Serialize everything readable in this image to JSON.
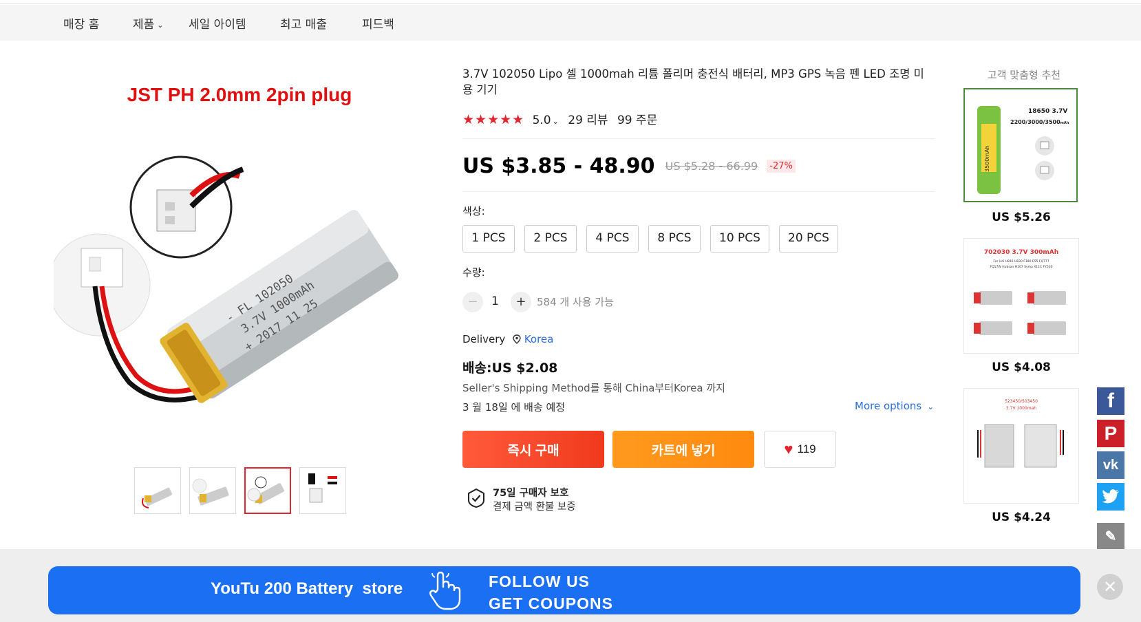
{
  "nav": {
    "items": [
      "매장 홈",
      "제품",
      "세일 아이템",
      "최고 매출",
      "피드백"
    ]
  },
  "gallery": {
    "image_caption": "JST PH 2.0mm 2pin plug",
    "battery_print": [
      "- FL 102050",
      "3.7V 1000mAh",
      "+ 2017 11 25"
    ],
    "thumbnails": [
      "thumb-1",
      "thumb-2",
      "thumb-3",
      "thumb-4"
    ],
    "active_thumbnail": 3
  },
  "product": {
    "title": "3.7V 102050 Lipo 셀 1000mah 리튬 폴리머 충전식 배터리, MP3 GPS 녹음 펜 LED 조명 미용 기기",
    "rating": "5.0",
    "reviews": "29 리뷰",
    "orders": "99 주문",
    "price": "US $3.85 - 48.90",
    "old_price": "US $5.28 - 66.99",
    "discount": "-27%",
    "color_label": "색상:",
    "options": [
      "1 PCS",
      "2 PCS",
      "4 PCS",
      "8 PCS",
      "10 PCS",
      "20 PCS"
    ],
    "quantity_label": "수량:",
    "quantity": "1",
    "available": "584 개 사용 가능",
    "delivery_label": "Delivery",
    "delivery_location": "Korea",
    "shipping_price": "배송:US $2.08",
    "shipping_method": "Seller's Shipping Method를 통해 China부터Korea 까지",
    "eta": "3 월 18일 에 배송 예정",
    "more_options": "More options",
    "buy_now": "즉시 구매",
    "add_to_cart": "카트에 넣기",
    "wishlist_count": "119",
    "protection_title": "75일 구매자 보호",
    "protection_sub": "결제 금액 환불 보증"
  },
  "recommendations": {
    "title": "고객 맞춤형 추천",
    "items": [
      {
        "price": "US $5.26",
        "label_1": "18650  3.7V",
        "label_2": "2200/3000/3500",
        "label_2_unit": "mAh",
        "cell_text": "3500mAh"
      },
      {
        "price": "US $4.08",
        "label_1": "702030 3.7V 300mAh",
        "label_2": "For Udi U816 U830 F180 E55 FQ777",
        "label_3": "FQ17W Hubsan H107 Syma X11C FY530"
      },
      {
        "price": "US $4.24",
        "label_1": "523450/503450",
        "label_2": "3.7V 1000mah"
      }
    ]
  },
  "social": {
    "icons": [
      "facebook-icon",
      "pinterest-icon",
      "vk-icon",
      "twitter-icon",
      "edit-icon"
    ]
  },
  "banner": {
    "store": "YouTu 200 Battery  store",
    "follow": "FOLLOW  US",
    "coupons": "GET COUPONS"
  },
  "colors": {
    "accent_red": "#e0262e",
    "buy_orange_red": "#f03a1e",
    "cart_orange": "#ff8a10",
    "link_blue": "#2a6fdb",
    "banner_blue": "#1a6ff2"
  }
}
